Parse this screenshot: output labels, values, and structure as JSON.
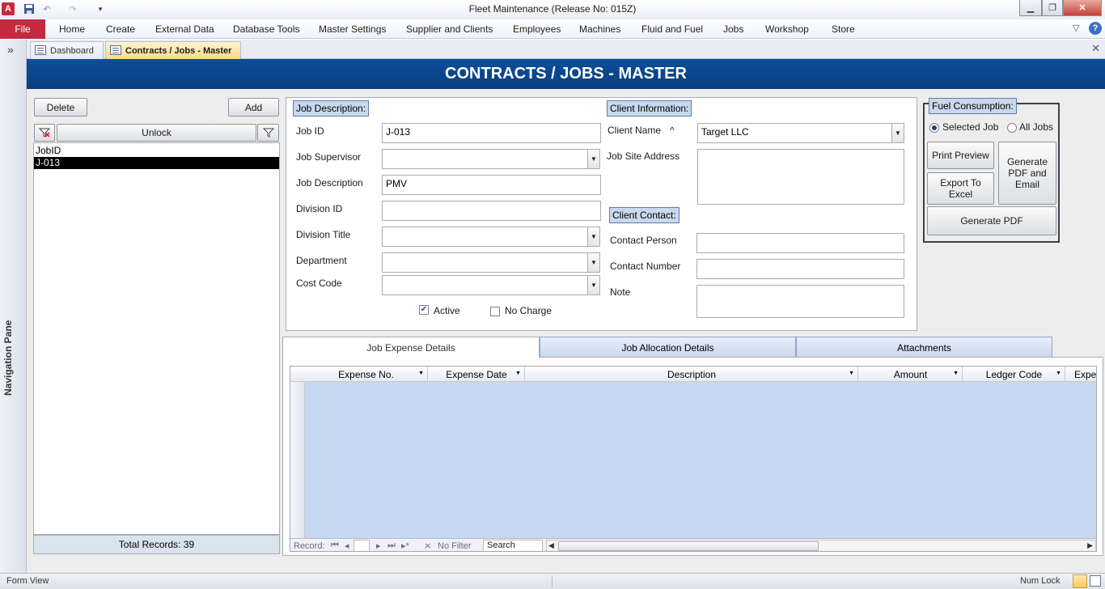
{
  "window": {
    "title": "Fleet Maintenance (Release No: 015Z)"
  },
  "ribbon": {
    "file": "File",
    "tabs": [
      "Home",
      "Create",
      "External Data",
      "Database Tools",
      "Master Settings",
      "Supplier and Clients",
      "Employees",
      "Machines",
      "Fluid and Fuel",
      "Jobs",
      "Workshop",
      "Store"
    ]
  },
  "nav_pane": {
    "label": "Navigation Pane",
    "toggle": "»"
  },
  "doc_tabs": [
    {
      "label": "Dashboard",
      "active": false
    },
    {
      "label": "Contracts / Jobs - Master",
      "active": true
    }
  ],
  "header": {
    "title": "CONTRACTS / JOBS - MASTER"
  },
  "left": {
    "delete_label": "Delete",
    "add_label": "Add",
    "unlock_label": "Unlock",
    "list_header": "JobID",
    "list_items": [
      "J-013"
    ],
    "total_records": "Total Records: 39"
  },
  "job": {
    "section": "Job Description:",
    "job_id_label": "Job ID",
    "job_id": "J-013",
    "supervisor_label": "Job Supervisor",
    "supervisor": "",
    "description_label": "Job Description",
    "description": "PMV",
    "division_id_label": "Division ID",
    "division_id": "",
    "division_title_label": "Division Title",
    "division_title": "",
    "department_label": "Department",
    "department": "",
    "cost_code_label": "Cost Code",
    "cost_code": "",
    "active_label": "Active",
    "active_checked": true,
    "no_charge_label": "No Charge",
    "no_charge_checked": false
  },
  "client": {
    "section": "Client Information:",
    "name_label": "Client Name",
    "name_sort_icon": "^",
    "name": "Target LLC",
    "site_label": "Job Site Address",
    "site": "",
    "contact_section": "Client Contact:",
    "person_label": "Contact Person",
    "person": "",
    "number_label": "Contact Number",
    "number": "",
    "note_label": "Note",
    "note": ""
  },
  "fuel": {
    "section": "Fuel Consumption:",
    "selected_job": "Selected Job",
    "all_jobs": "All Jobs",
    "print_preview": "Print Preview",
    "generate_pdf_email": "Generate PDF and Email",
    "export_excel": "Export To Excel",
    "generate_pdf": "Generate PDF"
  },
  "lower_tabs": [
    {
      "label": "Job Expense Details",
      "active": true
    },
    {
      "label": "Job Allocation Details",
      "active": false
    },
    {
      "label": "Attachments",
      "active": false
    }
  ],
  "datasheet": {
    "columns": [
      "Expense No.",
      "Expense Date",
      "Description",
      "Amount",
      "Ledger Code",
      "Expe"
    ]
  },
  "record_nav": {
    "label": "Record:",
    "no_filter": "No Filter",
    "search": "Search"
  },
  "status": {
    "left": "Form View",
    "num_lock": "Num Lock"
  },
  "colors": {
    "header_blue": "#0b4f9a",
    "file_tab": "#c42a3f",
    "section_label": "#c9d8ec",
    "datasheet_fill": "#c6d9f1"
  }
}
